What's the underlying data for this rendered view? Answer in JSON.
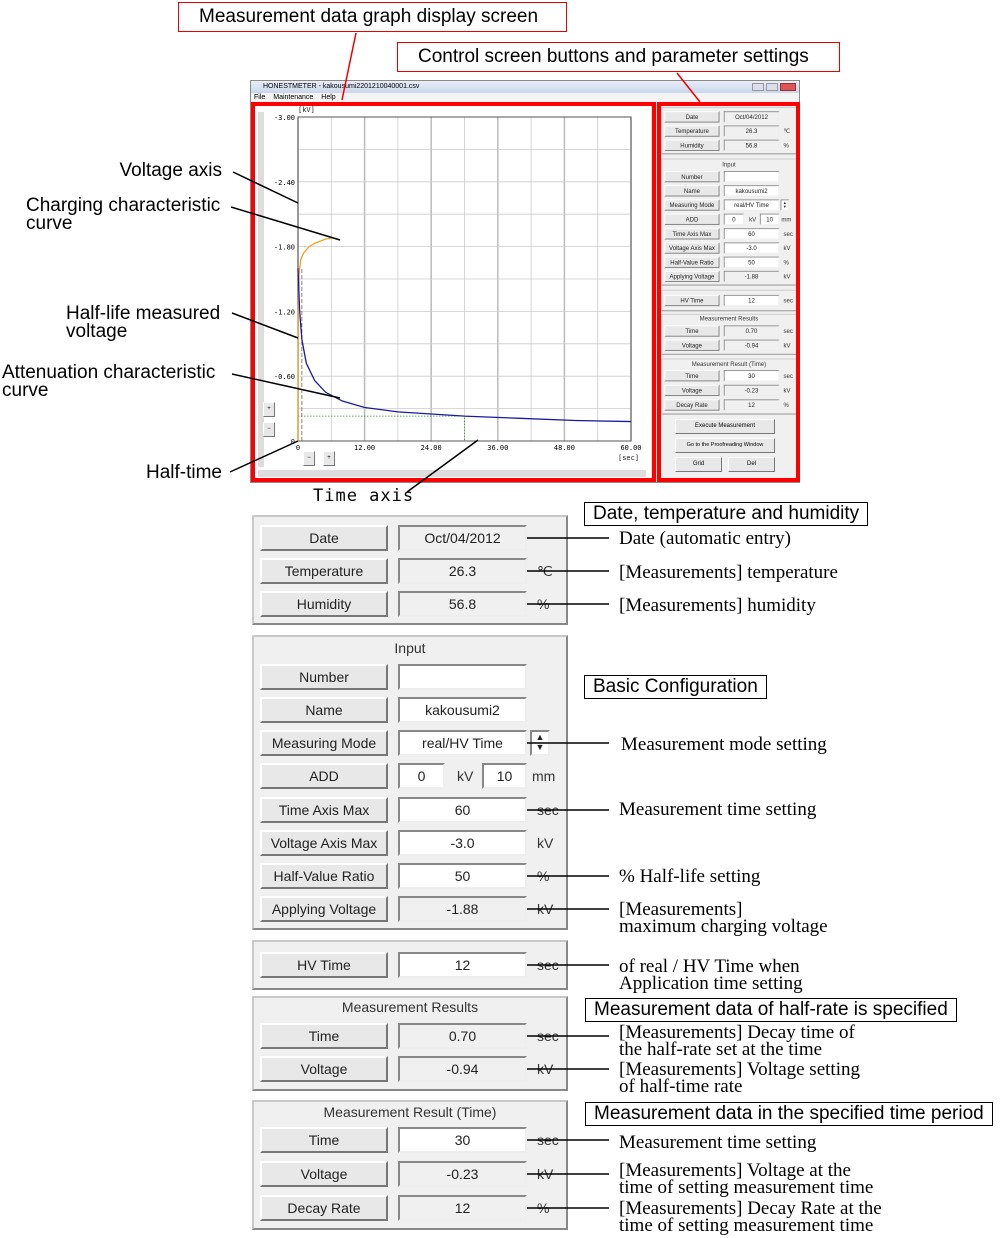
{
  "callouts": {
    "graph_screen": "Measurement data graph display screen",
    "control_screen": "Control screen buttons and parameter settings",
    "voltage_axis": "Voltage axis",
    "charging_curve": [
      "Charging characteristic",
      "curve"
    ],
    "half_life_voltage": [
      "Half-life measured",
      "voltage"
    ],
    "attenuation_curve": [
      "Attenuation characteristic",
      "curve"
    ],
    "half_time": "Half-time",
    "time_axis": "Time axis"
  },
  "window": {
    "title": "HONESTMETER - kakousumi2201210040001.csv",
    "menu": [
      "File",
      "Maintenance",
      "Help"
    ],
    "buttons": {
      "execute": "Execute Measurement",
      "proofreading": "Go to the Proofreading Window",
      "grid": "Grid",
      "del": "Del"
    }
  },
  "chart_data": {
    "type": "line",
    "ylabel": "[kV]",
    "xlabel": "[sec]",
    "xlim": [
      0,
      60
    ],
    "ylim": [
      0,
      -3.0
    ],
    "x_ticks": [
      "0",
      "12.00",
      "24.00",
      "36.00",
      "48.00",
      "60.00"
    ],
    "y_ticks": [
      "-3.00",
      "-2.40",
      "-1.80",
      "-1.20",
      "-0.60",
      "0"
    ],
    "grid": true,
    "series": [
      {
        "x": [
          0,
          0.05,
          0.2,
          0.5,
          1,
          2,
          3,
          4,
          5,
          6
        ],
        "y": [
          0,
          -1.2,
          -1.55,
          -1.68,
          -1.74,
          -1.8,
          -1.83,
          -1.85,
          -1.87,
          -1.88
        ],
        "color": "#f0a020"
      },
      {
        "x": [
          0,
          0.3,
          0.7,
          1.5,
          3,
          5,
          8,
          12,
          18,
          24,
          30,
          40,
          50,
          60
        ],
        "y": [
          -1.6,
          -1.2,
          -0.94,
          -0.72,
          -0.56,
          -0.45,
          -0.37,
          -0.31,
          -0.27,
          -0.25,
          -0.23,
          -0.21,
          -0.19,
          -0.18
        ],
        "color": "#1a1aa0"
      }
    ],
    "markers": {
      "half_time": 0.7,
      "measure_time": 30,
      "measure_voltage": -0.23
    },
    "zoom_buttons": [
      "+",
      "−"
    ]
  },
  "panel": {
    "env": {
      "date": {
        "label": "Date",
        "value": "Oct/04/2012"
      },
      "temperature": {
        "label": "Temperature",
        "value": "26.3",
        "unit": "℃"
      },
      "humidity": {
        "label": "Humidity",
        "value": "56.8",
        "unit": "%"
      }
    },
    "input": {
      "title": "Input",
      "number": {
        "label": "Number",
        "value": ""
      },
      "name": {
        "label": "Name",
        "value": "kakousumi2"
      },
      "mode": {
        "label": "Measuring Mode",
        "value": "real/HV Time"
      },
      "add": {
        "label": "ADD",
        "value1": "0",
        "unit1": "kV",
        "value2": "10",
        "unit2": "mm"
      },
      "time_max": {
        "label": "Time Axis Max",
        "value": "60",
        "unit": "sec"
      },
      "volt_max": {
        "label": "Voltage Axis Max",
        "value": "-3.0",
        "unit": "kV"
      },
      "half_ratio": {
        "label": "Half-Value Ratio",
        "value": "50",
        "unit": "%"
      },
      "applying": {
        "label": "Applying Voltage",
        "value": "-1.88",
        "unit": "kV"
      }
    },
    "hv": {
      "label": "HV Time",
      "value": "12",
      "unit": "sec"
    },
    "results": {
      "title": "Measurement Results",
      "time": {
        "label": "Time",
        "value": "0.70",
        "unit": "sec"
      },
      "voltage": {
        "label": "Voltage",
        "value": "-0.94",
        "unit": "kV"
      }
    },
    "results_time": {
      "title": "Measurement Result (Time)",
      "time": {
        "label": "Time",
        "value": "30",
        "unit": "sec"
      },
      "voltage": {
        "label": "Voltage",
        "value": "-0.23",
        "unit": "kV"
      },
      "decay": {
        "label": "Decay Rate",
        "value": "12",
        "unit": "%"
      }
    }
  },
  "notes": {
    "date_box": "Date, temperature and humidity",
    "date": "Date (automatic entry)",
    "temperature": "[Measurements] temperature",
    "humidity": "[Measurements] humidity",
    "basic_box": "Basic Configuration",
    "mode": "Measurement mode setting",
    "time": "Measurement time setting",
    "half": "% Half-life setting",
    "applying": [
      "[Measurements]",
      "maximum charging voltage"
    ],
    "hv": [
      "of real / HV Time when",
      "Application time setting"
    ],
    "half_box": "Measurement data of half-rate is specified",
    "res_time": [
      "[Measurements] Decay time of",
      "the half-rate set at the time"
    ],
    "res_volt": [
      "[Measurements] Voltage setting",
      "of half-time rate"
    ],
    "period_box": "Measurement data in the specified time period",
    "mrt_time": "Measurement time setting",
    "mrt_volt": [
      "[Measurements] Voltage at the",
      "time of setting measurement time"
    ],
    "mrt_decay": [
      "[Measurements] Decay Rate at the",
      "time of setting measurement time"
    ]
  }
}
